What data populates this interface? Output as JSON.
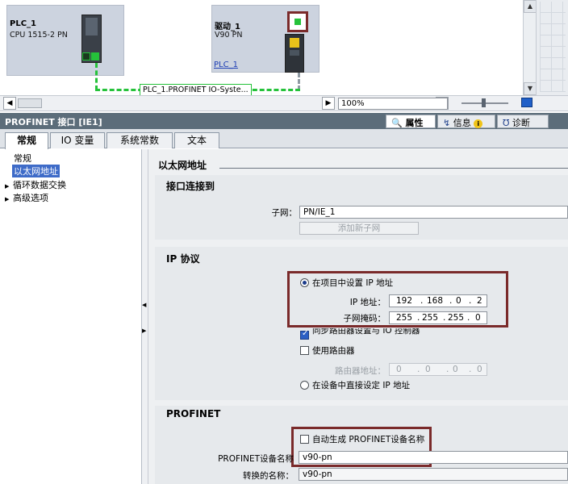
{
  "network": {
    "plc": {
      "name": "PLC_1",
      "type": "CPU 1515-2 PN"
    },
    "drive": {
      "name": "驱动_1",
      "type": "V90 PN",
      "link": "PLC_1"
    },
    "io_system_label": "PLC_1.PROFINET IO-Syste...",
    "zoom": "100%",
    "accent_green": "#25c23a"
  },
  "props": {
    "title": "PROFINET 接口 [IE1]",
    "header_tabs": [
      {
        "label": "属性",
        "icon": "properties-icon"
      },
      {
        "label": "信息",
        "icon": "info-icon"
      },
      {
        "label": "诊断",
        "icon": "diagnostics-icon"
      }
    ],
    "tabs": [
      "常规",
      "IO 变量",
      "系统常数",
      "文本"
    ]
  },
  "nav": {
    "items": [
      {
        "label": "常规"
      },
      {
        "label": "以太网地址"
      },
      {
        "label": "循环数据交换"
      },
      {
        "label": "高级选项"
      }
    ]
  },
  "content": {
    "heading": "以太网地址",
    "interface": {
      "title": "接口连接到",
      "subnet_label": "子网：",
      "subnet_value": "PN/IE_1",
      "add_subnet": "添加新子网"
    },
    "ip": {
      "title": "IP 协议",
      "set_in_project": "在项目中设置 IP 地址",
      "ip_label": "IP 地址：",
      "ip": [
        "192",
        "168",
        "0",
        "2"
      ],
      "mask_label": "子网掩码：",
      "mask": [
        "255",
        "255",
        "255",
        "0"
      ],
      "sync_router": "同步路由器设置与 IO 控制器",
      "use_router": "使用路由器",
      "router_label": "路由器地址：",
      "router": [
        "0",
        "0",
        "0",
        "0"
      ],
      "set_on_device": "在设备中直接设定 IP 地址"
    },
    "profinet": {
      "title": "PROFINET",
      "auto_generate": "自动生成 PROFINET设备名称",
      "device_name_label": "PROFINET设备名称",
      "device_name": "v90-pn",
      "converted_label": "转换的名称：",
      "converted": "v90-pn"
    },
    "highlight_color": "#7a2a2a"
  }
}
